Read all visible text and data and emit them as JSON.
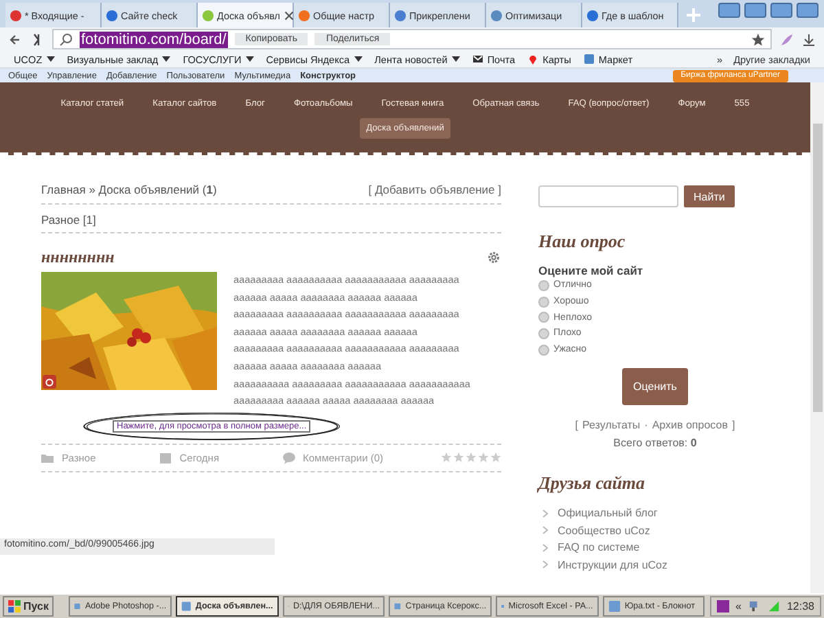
{
  "browser_tabs": [
    {
      "label": "* Входящие -",
      "selected": false
    },
    {
      "label": "Сайте check",
      "selected": false
    },
    {
      "label": "Доска объявл",
      "selected": true
    },
    {
      "label": "Общие настр",
      "selected": false
    },
    {
      "label": "Прикреплени",
      "selected": false
    },
    {
      "label": "Оптимизаци",
      "selected": false
    },
    {
      "label": "Где в шаблон",
      "selected": false
    }
  ],
  "address_bar": {
    "url": "fotomitino.com/board/",
    "buttons": [
      "Копировать",
      "Поделиться"
    ]
  },
  "bookmarks": [
    {
      "label": "UCOZ",
      "kind": "folder"
    },
    {
      "label": "Визуальные заклад",
      "kind": "folder"
    },
    {
      "label": "ГОСУСЛУГИ",
      "kind": "folder"
    },
    {
      "label": "Сервисы Яндекса",
      "kind": "folder"
    },
    {
      "label": "Лента новостей",
      "kind": "folder"
    },
    {
      "label": "Почта",
      "kind": "mail"
    },
    {
      "label": "Карты",
      "kind": "pin"
    },
    {
      "label": "Маркет",
      "kind": "market"
    }
  ],
  "bookmarks_more": "»",
  "bookmarks_other": "Другие закладки",
  "admin_bar": {
    "items": [
      {
        "label": "Общее",
        "selected": false
      },
      {
        "label": "Управление",
        "selected": false
      },
      {
        "label": "Добавление",
        "selected": false
      },
      {
        "label": "Пользователи",
        "selected": false
      },
      {
        "label": "Мультимедиа",
        "selected": false
      },
      {
        "label": "Конструктор",
        "selected": true
      }
    ],
    "badge": "Биржа фриланса uPartner"
  },
  "site_nav": [
    {
      "label": "Каталог статей",
      "selected": false
    },
    {
      "label": "Каталог сайтов",
      "selected": false
    },
    {
      "label": "Блог",
      "selected": false
    },
    {
      "label": "Фотоальбомы",
      "selected": false
    },
    {
      "label": "Гостевая книга",
      "selected": false
    },
    {
      "label": "Обратная связь",
      "selected": false
    },
    {
      "label": "FAQ (вопрос/ответ)",
      "selected": false
    },
    {
      "label": "Форум",
      "selected": false
    },
    {
      "label": "555",
      "selected": false
    },
    {
      "label": "Доска объявлений",
      "selected": true
    }
  ],
  "breadcrumb": "Главная » Доска объявлений (**1**)",
  "add_link": "[ Добавить объявление ]",
  "category": "Разное [1]",
  "ad": {
    "title": "нннннннн",
    "text_lines": [
      "ааааааааа аааааааааа ааааааааааа ааааааааа",
      "аааааа ааааа аааааааа аааааа аааааа",
      "ааааааааа аааааааааа ааааааааааа ааааааааа",
      "аааааа ааааа аааааааа аааааа аааааа",
      "ааааааааа аааааааааа ааааааааааа ааааааааа",
      "аааааа ааааа аааааааа аааааа",
      "аааааааааа ааааааааа ааааааааааа ааааааааааа",
      "ааааааааа аааааа ааааа аааааааа аааааа"
    ],
    "tooltip": "Нажмите, для просмотра в полном размере...",
    "category": "Разное",
    "date": "Сегодня",
    "comments": "Комментарии (0)",
    "stars": 0
  },
  "search": {
    "button": "Найти"
  },
  "poll": {
    "heading": "Наш опрос",
    "question": "Оцените мой сайт",
    "options": [
      {
        "label": "Отлично",
        "selected": false
      },
      {
        "label": "Хорошо",
        "selected": false
      },
      {
        "label": "Неплохо",
        "selected": false
      },
      {
        "label": "Плохо",
        "selected": false
      },
      {
        "label": "Ужасно",
        "selected": false
      }
    ],
    "button": "Оценить",
    "bracket_open": "[",
    "results": "Результаты",
    "separator": "·",
    "archive": "Архив опросов",
    "bracket_close": "]",
    "total": "Всего ответов: **0**"
  },
  "friends": {
    "heading": "Друзья сайта",
    "links": [
      "Официальный блог",
      "Сообщество uCoz",
      "FAQ по системе",
      "Инструкции для uCoz"
    ]
  },
  "status_url": "fotomitino.com/_bd/0/99005466.jpg",
  "taskbar": {
    "start": "Пуск",
    "items": [
      {
        "label": "Adobe Photoshop -...",
        "selected": false
      },
      {
        "label": "Доска объявлен...",
        "selected": true
      },
      {
        "label": "D:\\ДЛЯ ОБЯВЛЕНИ...",
        "selected": false
      },
      {
        "label": "Страница Ксерокс...",
        "selected": false
      },
      {
        "label": "Microsoft Excel - РА...",
        "selected": false
      },
      {
        "label": "Юра.txt - Блокнот",
        "selected": false
      }
    ],
    "tray_arrow": "«",
    "time": "12:38"
  }
}
